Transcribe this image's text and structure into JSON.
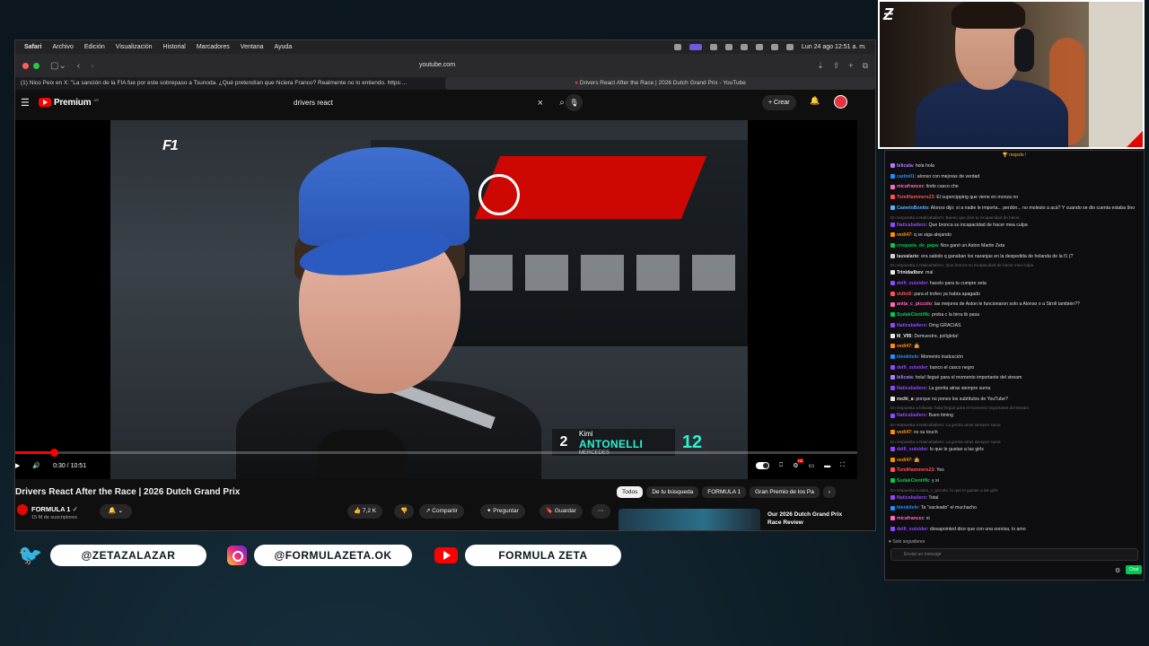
{
  "menubar": {
    "items": [
      "Safari",
      "Archivo",
      "Edición",
      "Visualización",
      "Historial",
      "Marcadores",
      "Ventana",
      "Ayuda"
    ],
    "clock": "Lun 24 ago 12:51 a. m."
  },
  "browser": {
    "url": "youtube.com",
    "tabs": [
      "(1) Nico Peix en X: \"La sanción de la FIA fue por este sobrepaso a Tsunoda. ¿Qué pretendían que hiciera Franco? Realmente no lo entiendo. https:...",
      "Drivers React After the Race | 2026 Dutch Grand Prix - YouTube"
    ]
  },
  "youtube": {
    "logo": "Premium",
    "logo_suffix": "AR",
    "search_value": "drivers react",
    "create_label": "Crear",
    "player": {
      "watermark": "F1",
      "time": "0:30 / 10:51",
      "progress": 0.046,
      "lower_third": {
        "position": "2",
        "first": "Kimi",
        "last": "ANTONELLI",
        "team": "MERCEDES",
        "number": "12"
      }
    },
    "video_title": "Drivers React After the Race | 2026 Dutch Grand Prix",
    "channel": {
      "name": "FORMULA 1",
      "subs": "15 M de suscriptores"
    },
    "actions": {
      "likes": "7,2 K",
      "share": "Compartir",
      "ask": "Preguntar",
      "save": "Guardar"
    },
    "chips": [
      "Todos",
      "De tu búsqueda",
      "FORMULA 1",
      "Gran Premio de los Pa"
    ],
    "reco_title": "Our 2026 Dutch Grand Prix Race Review"
  },
  "chat": {
    "pinned": "mejedo !",
    "messages": [
      {
        "user": "bilicata",
        "color": "#b07bff",
        "text": "hola hola"
      },
      {
        "user": "carito01",
        "color": "#1e90ff",
        "text": "alonso con mejoras de verdad"
      },
      {
        "user": "micafrancez",
        "color": "#ff69b4",
        "text": "lindo casco che"
      },
      {
        "user": "TomiHammers23",
        "color": "#ff4f4f",
        "text": "El supercipping que viene en monza no"
      },
      {
        "user": "CameloBonito",
        "color": "#5ab0ff",
        "text": "Alonso dijo: si a nadie le importa... perdón... no molesto a acá? Y cuando se dio cuenta estaba 9no"
      },
      {
        "user": "Naticabailero",
        "color": "#9147ff",
        "text": "Que bronca su incapacidad de hacer mea culpa",
        "reply": "En respuesta a Naticabailero: Bueno que dice tu incapacidad de hacer..."
      },
      {
        "user": "vedi47",
        "color": "#ff8c00",
        "text": "q se siga alejando"
      },
      {
        "user": "croqueta_de_papa",
        "color": "#00c853",
        "text": "Nos ganó un Aston Martin Zeta"
      },
      {
        "user": "lauvalario",
        "color": "#d1d1d1",
        "text": "era sabido q ganaban los naranjas en la despedida de holanda de la f1 (?"
      },
      {
        "user": "Trinidadbev",
        "color": "#eaeaea",
        "text": "mal",
        "reply": "En respuesta a Naticabailero: Que bronca su incapacidad de hacer mea culpa"
      },
      {
        "user": "delfi_outsider",
        "color": "#9147ff",
        "text": "hacelo para tu cumpre zeta"
      },
      {
        "user": "vidini5",
        "color": "#ff4f4f",
        "text": "para el trofeo ya había apagado"
      },
      {
        "user": "anita_c_piccolo",
        "color": "#ff69b4",
        "text": "las mejores de Aston le funcionaron solo a Alonso o a Stroll también??"
      },
      {
        "user": "SudakClentifik",
        "color": "#00c853",
        "text": "proba c la birra tb pasa"
      },
      {
        "user": "Naticabailero",
        "color": "#9147ff",
        "text": "Omg GRACIAS"
      },
      {
        "user": "M_V95",
        "color": "#eaeaea",
        "text": "Demuestre, políglota!"
      },
      {
        "user": "vedi47",
        "color": "#ff8c00",
        "text": "🤷"
      },
      {
        "user": "blenkitelv",
        "color": "#1e90ff",
        "text": "Momento traducción"
      },
      {
        "user": "delfi_outsider",
        "color": "#9147ff",
        "text": "banco el casco negro"
      },
      {
        "user": "bilicata",
        "color": "#b07bff",
        "text": "hola! llegué para el momento importante del stream"
      },
      {
        "user": "Naticabailero",
        "color": "#9147ff",
        "text": "La gorrita atras siempre suma"
      },
      {
        "user": "rochi_a",
        "color": "#eaeaea",
        "text": "porque no pones los subtítulos de YouTube?"
      },
      {
        "user": "Naticabailero",
        "color": "#9147ff",
        "text": "Buen timing",
        "reply": "En respuesta a bilicata: hola! llegué para el momento importante del stream"
      },
      {
        "user": "vedi47",
        "color": "#ff8c00",
        "text": "es su touch",
        "reply": "En respuesta a Naticabailero: La gorrita atras siempre suma"
      },
      {
        "user": "delfi_outsider",
        "color": "#9147ff",
        "text": "lo que le gustan a las girls",
        "reply": "En respuesta a Naticabailero: La gorrita atras siempre suma"
      },
      {
        "user": "vedi47",
        "color": "#ff8c00",
        "text": "🤷"
      },
      {
        "user": "TomiHammers23",
        "color": "#ff4f4f",
        "text": "Yes"
      },
      {
        "user": "SudakClentifik",
        "color": "#00c853",
        "text": "y si"
      },
      {
        "user": "Naticabailero",
        "color": "#9147ff",
        "text": "Total",
        "reply": "En respuesta a anita_c_piccolo: lo que le gustan a las girls"
      },
      {
        "user": "blenkitelv",
        "color": "#1e90ff",
        "text": "Ta \"sacleado\" el muchacho"
      },
      {
        "user": "micafrancez",
        "color": "#ff69b4",
        "text": "si"
      },
      {
        "user": "delfi_outsider",
        "color": "#9147ff",
        "text": "dissapointed dice que con una sonrisa, lo amo"
      }
    ],
    "viewers": "Solo seguidores",
    "input_placeholder": "Enviar un mensaje",
    "send_label": "Chat"
  },
  "socials": {
    "twitter": "@ZETAZALAZAR",
    "instagram": "@FORMULAZETA.OK",
    "youtube": "FORMULA ZETA"
  }
}
